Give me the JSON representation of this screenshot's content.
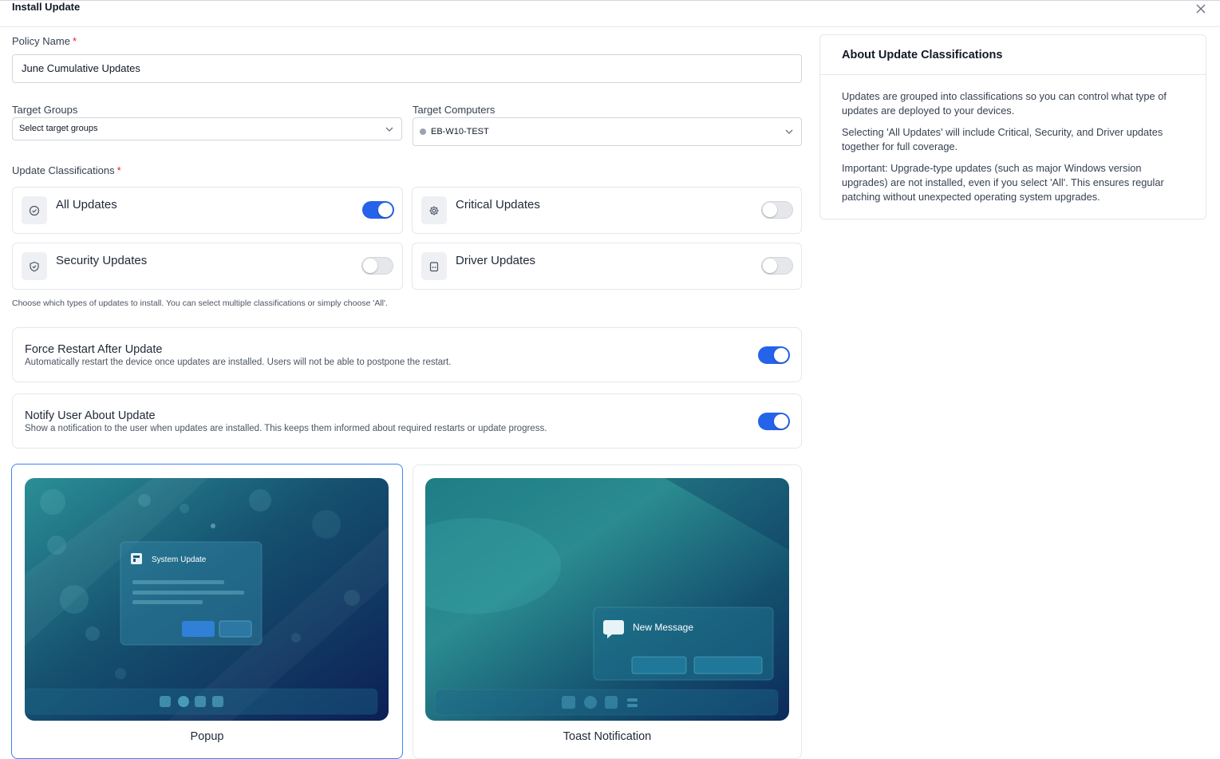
{
  "dialog": {
    "title": "Install Update"
  },
  "policy": {
    "label": "Policy Name",
    "required": "*",
    "value": "June Cumulative Updates"
  },
  "target_groups": {
    "label": "Target Groups",
    "placeholder": "Select target groups"
  },
  "target_computers": {
    "label": "Target Computers",
    "value": "EB-W10-TEST"
  },
  "classifications": {
    "label": "Update Classifications",
    "required": "*",
    "items": [
      {
        "name": "All Updates",
        "icon": "check-circle-icon",
        "enabled": true
      },
      {
        "name": "Critical Updates",
        "icon": "gear-icon",
        "enabled": false
      },
      {
        "name": "Security Updates",
        "icon": "shield-icon",
        "enabled": false
      },
      {
        "name": "Driver Updates",
        "icon": "driver-icon",
        "enabled": false
      }
    ],
    "hint": "Choose which types of updates to install. You can select multiple classifications or simply choose 'All'."
  },
  "force_restart": {
    "title": "Force Restart After Update",
    "description": "Automatically restart the device once updates are installed. Users will not be able to postpone the restart.",
    "enabled": true
  },
  "notify_user": {
    "title": "Notify User About Update",
    "description": "Show a notification to the user when updates are installed. This keeps them informed about required restarts or update progress.",
    "enabled": true
  },
  "notification_styles": [
    {
      "name": "Popup",
      "selected": true,
      "preview_title": "System Update"
    },
    {
      "name": "Toast Notification",
      "selected": false,
      "preview_title": "New Message"
    }
  ],
  "info_panel": {
    "title": "About Update Classifications",
    "paragraphs": [
      "Updates are grouped into classifications so you can control what type of updates are deployed to your devices.",
      "Selecting 'All Updates' will include Critical, Security, and Driver updates together for full coverage.",
      "Important: Upgrade-type updates (such as major Windows version upgrades) are not installed, even if you select 'All'. This ensures regular patching without unexpected operating system upgrades."
    ]
  },
  "colors": {
    "accent": "#2563eb",
    "required": "#dc2626"
  }
}
